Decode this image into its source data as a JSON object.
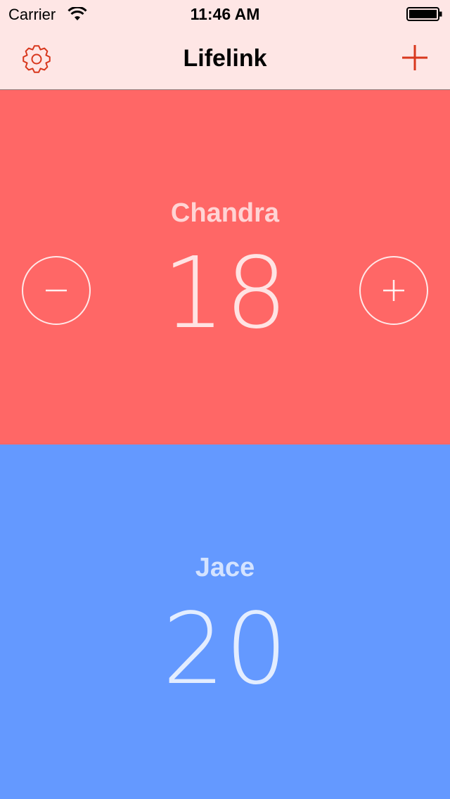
{
  "status_bar": {
    "carrier": "Carrier",
    "time": "11:46 AM",
    "wifi_icon": "wifi-icon",
    "battery_icon": "battery-icon"
  },
  "nav": {
    "title": "Lifelink",
    "settings_icon": "gear-icon",
    "add_icon": "plus-icon",
    "background": "#fee6e5",
    "tint": "#d8371d"
  },
  "players": [
    {
      "name": "Chandra",
      "life": "18",
      "background": "#ff6766",
      "decrement_icon": "minus-circle-icon",
      "increment_icon": "plus-circle-icon"
    },
    {
      "name": "Jace",
      "life": "20",
      "background": "#6499ff"
    }
  ]
}
